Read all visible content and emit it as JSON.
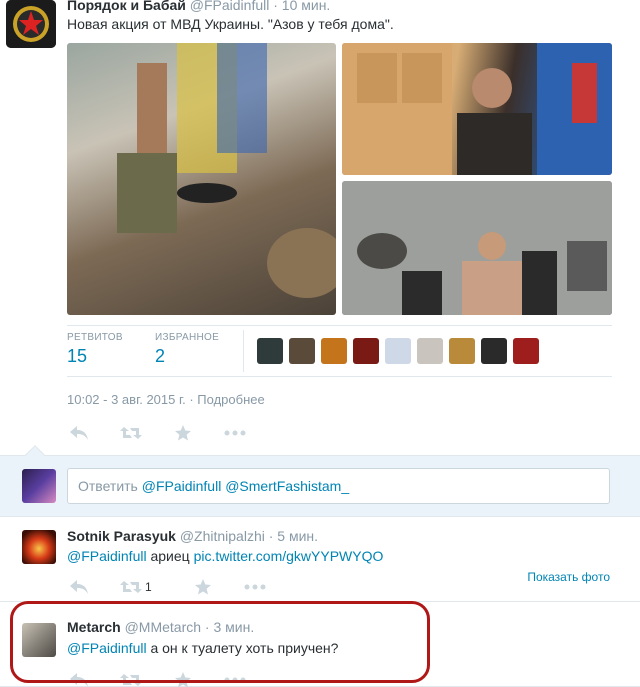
{
  "main_tweet": {
    "author_name": "Порядок и Бабай",
    "author_handle": "@FPaidinfull",
    "time": "· 10 мин.",
    "text": "Новая акция от МВД Украины. \"Азов у тебя дома\".",
    "stats": {
      "retweets_label": "РЕТВИТОВ",
      "retweets_value": "15",
      "favorites_label": "ИЗБРАННОЕ",
      "favorites_value": "2"
    },
    "timestamp": "10:02 - 3 авг. 2015 г. · Подробнее",
    "favoriter_avatar_colors": [
      "#2f3b3a",
      "#5a4a3a",
      "#c4741a",
      "#7a1a14",
      "#cfd8e6",
      "#c9c4bd",
      "#b88a3a",
      "#2a2a2a",
      "#9e1e1e"
    ]
  },
  "reply_box": {
    "prefix": "Ответить",
    "mention_1": "@FPaidinfull",
    "mention_2": "@SmertFashistam_"
  },
  "replies": [
    {
      "author_name": "Sotnik Parasyuk",
      "author_handle": "@Zhitnipalzhi",
      "time": "· 5 мин.",
      "mention": "@FPaidinfull",
      "text": " ариец ",
      "link": "pic.twitter.com/gkwYYPWYQO",
      "retweet_count": "1",
      "show_photo": "Показать фото"
    },
    {
      "author_name": "Metarch",
      "author_handle": "@MMetarch",
      "time": "· 3 мин.",
      "mention": "@FPaidinfull",
      "text": " а он к туалету хоть приучен?"
    }
  ],
  "colors": {
    "link": "#0084b4",
    "muted": "#8899a6",
    "highlight": "#b01818",
    "reply_bg": "#eaf3f9"
  },
  "icons": {
    "reply": "reply-icon",
    "retweet": "retweet-icon",
    "favorite": "star-icon",
    "more": "more-icon"
  }
}
